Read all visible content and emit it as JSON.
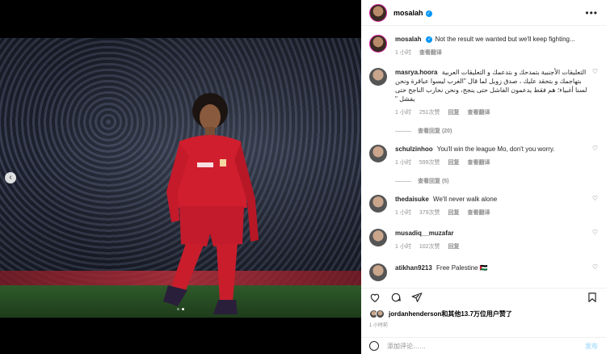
{
  "header": {
    "username": "mosalah"
  },
  "comments": [
    {
      "username": "mosalah",
      "text": "Not the result we wanted but we'll keep fighting...",
      "time": "1 小时",
      "translate": "查看翻译"
    },
    {
      "username": "masrya.hoora",
      "text": "التعليقات الأجنبية بتمدحك و بتدعمك و التعليقات العربية بتهاجمك و بتحقد عليك ، صدق زويل لما قال \"الغرب ليسوا عباقرة ونحن لسنا أغبياء؛ هم فقط يدعمون الفاشل حتى ينجح، ونحن نحارب الناجح حتى يفشل \"",
      "time": "1 小时",
      "likes": "251次赞",
      "reply": "回复",
      "translate": "查看翻译",
      "view_replies": "查看回复 (20)"
    },
    {
      "username": "schulzinhoo",
      "text": "You'll win the league Mo, don't you worry.",
      "time": "1 小时",
      "likes": "599次赞",
      "reply": "回复",
      "translate": "查看翻译",
      "view_replies": "查看回复 (5)"
    },
    {
      "username": "thedaisuke",
      "text": "We'll never walk alone",
      "time": "1 小时",
      "likes": "379次赞",
      "reply": "回复",
      "translate": "查看翻译"
    },
    {
      "username": "musadiq__muzafar",
      "text": "",
      "time": "1 小时",
      "likes": "102次赞",
      "reply": "回复"
    },
    {
      "username": "atikhan9213",
      "text": "Free Palestine 🇵🇸",
      "time": "",
      "likes": "",
      "reply": ""
    }
  ],
  "likes": {
    "user": "jordanhenderson",
    "rest": "和其他13.7万位用户赞了"
  },
  "post_time": "1 小时前",
  "add_comment": {
    "placeholder": "添加评论……",
    "post_label": "发布"
  },
  "icons": {
    "heart": "heart-icon",
    "comment": "comment-icon",
    "share": "share-icon",
    "save": "bookmark-icon",
    "emoji": "emoji-icon",
    "more": "more-icon",
    "prev": "chevron-left-icon"
  },
  "colors": {
    "verified": "#0095f6",
    "kit_red": "#d01e2e",
    "ring": "#d6249f"
  }
}
